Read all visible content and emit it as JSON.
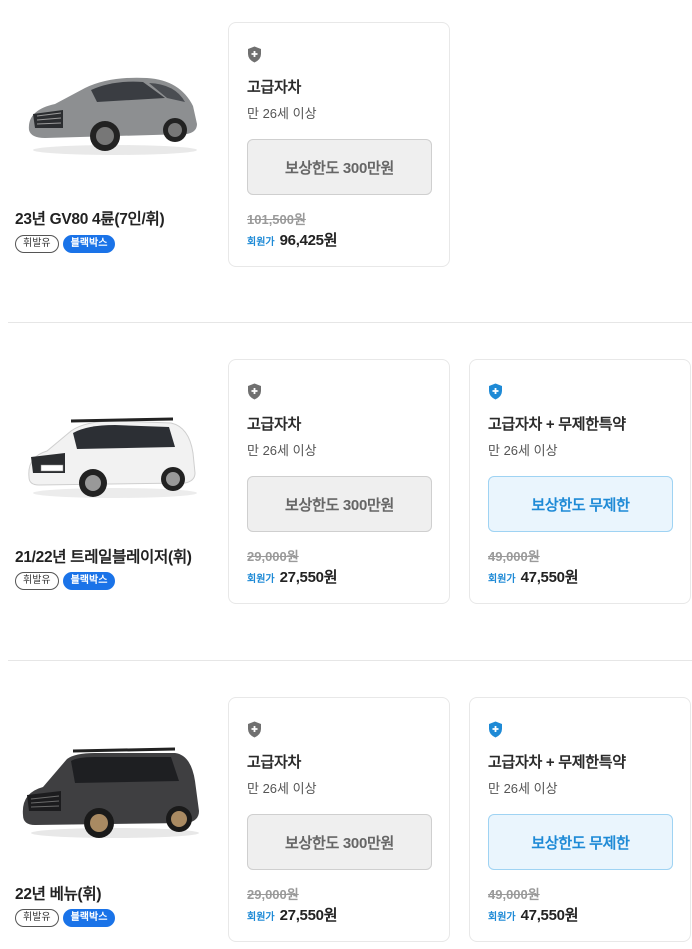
{
  "colors": {
    "accent": "#1e8ad6",
    "badge": "#1a73e8",
    "gray_button": "#efefef"
  },
  "cars": [
    {
      "name": "23년 GV80 4륜(7인/휘)",
      "tags": {
        "fuel": "휘발유",
        "blackbox": "블랙박스"
      },
      "image": "car-suv-coupe-gray",
      "plans": [
        {
          "icon": "shield-icon",
          "title": "고급자차",
          "age": "만 26세 이상",
          "limit": "보상한도 300만원",
          "original_price": "101,500원",
          "member_label": "회원가",
          "member_price": "96,425원",
          "style": "gray"
        }
      ]
    },
    {
      "name": "21/22년 트레일블레이저(휘)",
      "tags": {
        "fuel": "휘발유",
        "blackbox": "블랙박스"
      },
      "image": "car-suv-white",
      "plans": [
        {
          "icon": "shield-icon",
          "title": "고급자차",
          "age": "만 26세 이상",
          "limit": "보상한도 300만원",
          "original_price": "29,000원",
          "member_label": "회원가",
          "member_price": "27,550원",
          "style": "gray"
        },
        {
          "icon": "shield-icon",
          "title": "고급자차 + 무제한특약",
          "age": "만 26세 이상",
          "limit": "보상한도 무제한",
          "original_price": "49,000원",
          "member_label": "회원가",
          "member_price": "47,550원",
          "style": "blue"
        }
      ]
    },
    {
      "name": "22년 베뉴(휘)",
      "tags": {
        "fuel": "휘발유",
        "blackbox": "블랙박스"
      },
      "image": "car-suv-dark",
      "plans": [
        {
          "icon": "shield-icon",
          "title": "고급자차",
          "age": "만 26세 이상",
          "limit": "보상한도 300만원",
          "original_price": "29,000원",
          "member_label": "회원가",
          "member_price": "27,550원",
          "style": "gray"
        },
        {
          "icon": "shield-icon",
          "title": "고급자차 + 무제한특약",
          "age": "만 26세 이상",
          "limit": "보상한도 무제한",
          "original_price": "49,000원",
          "member_label": "회원가",
          "member_price": "47,550원",
          "style": "blue"
        }
      ]
    }
  ]
}
